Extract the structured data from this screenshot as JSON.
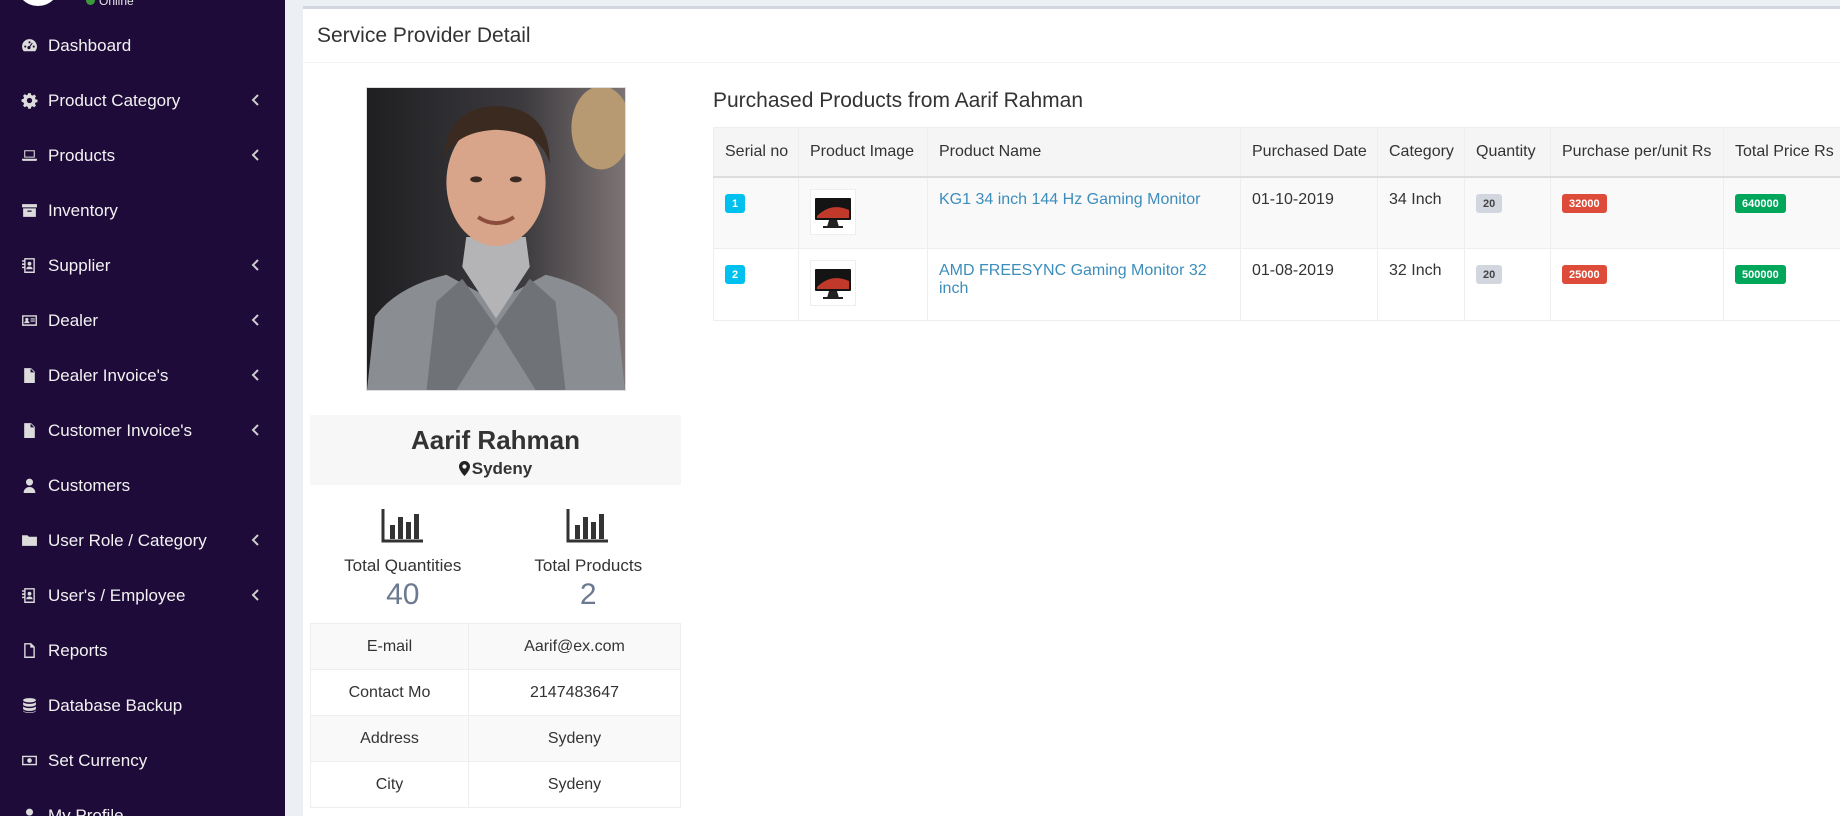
{
  "sidebar": {
    "status": "Online",
    "items": [
      {
        "label": "Dashboard",
        "icon": "dashboard-icon",
        "has_children": false
      },
      {
        "label": "Product Category",
        "icon": "gear-icon",
        "has_children": true
      },
      {
        "label": "Products",
        "icon": "laptop-icon",
        "has_children": true
      },
      {
        "label": "Inventory",
        "icon": "archive-icon",
        "has_children": false
      },
      {
        "label": "Supplier",
        "icon": "address-book-icon",
        "has_children": true
      },
      {
        "label": "Dealer",
        "icon": "id-card-icon",
        "has_children": true
      },
      {
        "label": "Dealer Invoice's",
        "icon": "file-icon",
        "has_children": true
      },
      {
        "label": "Customer Invoice's",
        "icon": "file-icon",
        "has_children": true
      },
      {
        "label": "Customers",
        "icon": "user-icon",
        "has_children": false
      },
      {
        "label": "User Role / Category",
        "icon": "folder-icon",
        "has_children": true
      },
      {
        "label": "User's / Employee",
        "icon": "address-book-icon",
        "has_children": true
      },
      {
        "label": "Reports",
        "icon": "file-outline-icon",
        "has_children": false
      },
      {
        "label": "Database Backup",
        "icon": "database-icon",
        "has_children": false
      },
      {
        "label": "Set Currency",
        "icon": "money-icon",
        "has_children": false
      },
      {
        "label": "My Profile",
        "icon": "user-icon",
        "has_children": false
      }
    ]
  },
  "page": {
    "title": "Service Provider Detail"
  },
  "profile": {
    "name": "Aarif Rahman",
    "city": "Sydeny",
    "stats": [
      {
        "label": "Total Quantities",
        "value": "40",
        "icon": "bar-chart-icon"
      },
      {
        "label": "Total Products",
        "value": "2",
        "icon": "bar-chart-icon"
      }
    ],
    "details": [
      {
        "key": "E-mail",
        "value": "Aarif@ex.com"
      },
      {
        "key": "Contact Mo",
        "value": "2147483647"
      },
      {
        "key": "Address",
        "value": "Sydeny"
      },
      {
        "key": "City",
        "value": "Sydeny"
      }
    ]
  },
  "products": {
    "title": "Purchased Products from Aarif Rahman",
    "columns": [
      "Serial no",
      "Product Image",
      "Product Name",
      "Purchased Date",
      "Category",
      "Quantity",
      "Purchase per/unit Rs",
      "Total Price Rs"
    ],
    "rows": [
      {
        "serial": "1",
        "name": "KG1 34 inch 144 Hz Gaming Monitor",
        "date": "01-10-2019",
        "category": "34 Inch",
        "quantity": "20",
        "unit_price": "32000",
        "total": "640000"
      },
      {
        "serial": "2",
        "name": "AMD FREESYNC Gaming Monitor 32 inch",
        "date": "01-08-2019",
        "category": "32 Inch",
        "quantity": "20",
        "unit_price": "25000",
        "total": "500000"
      }
    ]
  }
}
